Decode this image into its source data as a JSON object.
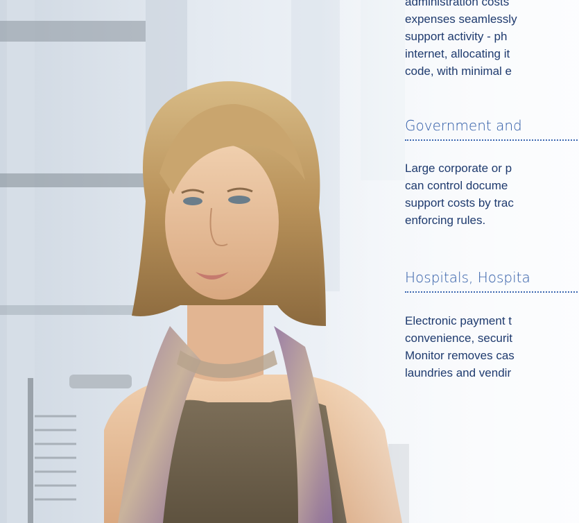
{
  "intro": {
    "lines": [
      "administration costs",
      "expenses seamlessly",
      "support activity - ph",
      "internet, allocating it",
      "code, with minimal e"
    ]
  },
  "sections": [
    {
      "heading": "Government and",
      "lines": [
        "Large corporate or p",
        "can control docume",
        "support costs by trac",
        "enforcing rules."
      ]
    },
    {
      "heading": "Hospitals, Hospita",
      "lines": [
        "Electronic payment t",
        "convenience, securit",
        "Monitor removes cas",
        "laundries and vendir"
      ]
    }
  ],
  "colors": {
    "body_text": "#1e3a6e",
    "heading": "#2d5aa6"
  }
}
